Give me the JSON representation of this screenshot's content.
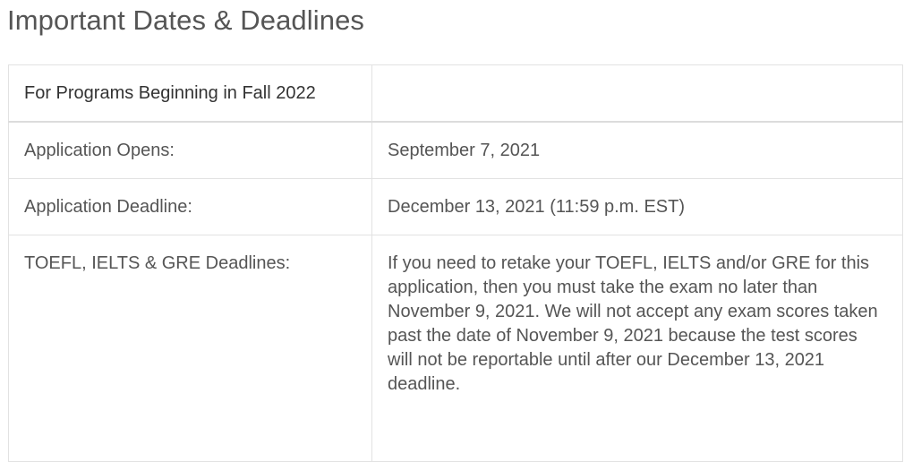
{
  "page": {
    "title": "Important Dates & Deadlines"
  },
  "table": {
    "header": {
      "col1": "For Programs Beginning in Fall 2022",
      "col2": ""
    },
    "rows": [
      {
        "label": "Application Opens:",
        "value": "September 7, 2021"
      },
      {
        "label": "Application Deadline:",
        "value": "December 13, 2021 (11:59 p.m. EST)"
      },
      {
        "label": "TOEFL, IELTS & GRE Deadlines:",
        "value": "If you need to retake your TOEFL, IELTS and/or GRE for this application, then you must take the exam no later than November 9, 2021. We will not accept any exam scores taken past the date of November 9, 2021 because the test scores will not be reportable until after our December 13, 2021 deadline."
      }
    ]
  }
}
